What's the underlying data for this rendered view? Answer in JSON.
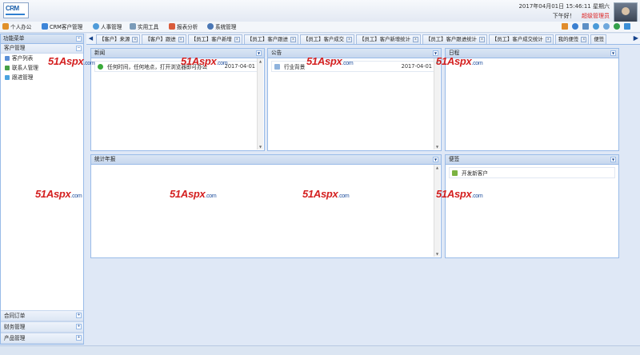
{
  "app": {
    "logo_text": "CRM"
  },
  "header": {
    "datetime": "2017年04月01日 15:46:11 星期六",
    "greeting": "下午好！",
    "user_role": "超级管理员"
  },
  "menu": [
    {
      "label": "个人办公",
      "icon": "home-icon",
      "color": "#e0902a"
    },
    {
      "label": "CRM客户管理",
      "icon": "crm-icon",
      "color": "#3d85d8"
    },
    {
      "label": "人事管理",
      "icon": "people-icon",
      "color": "#4f9bd9"
    },
    {
      "label": "实用工具",
      "icon": "tools-icon",
      "color": "#7a9bb9"
    },
    {
      "label": "报表分析",
      "icon": "chart-icon",
      "color": "#d95b3a"
    },
    {
      "label": "系统管理",
      "icon": "system-icon",
      "color": "#4a77b5"
    }
  ],
  "sidebar": {
    "title": "功能菜单",
    "group": "客户管理",
    "items": [
      {
        "label": "客户列表",
        "icon": "customer-list-icon",
        "color": "#5a8fd6"
      },
      {
        "label": "联系人管理",
        "icon": "contact-icon",
        "color": "#46a046"
      },
      {
        "label": "跟进管理",
        "icon": "followup-icon",
        "color": "#4aa3df"
      }
    ],
    "bottom_groups": [
      "合同订单",
      "财务管理",
      "产品管理"
    ]
  },
  "tabs": [
    "【客户】来源",
    "【客户】跟进",
    "【员工】客户新增",
    "【员工】客户跟进",
    "【员工】客户成交",
    "【员工】客户新增统计",
    "【员工】客户跟进统计",
    "【员工】客户成交统计",
    "我的便签",
    "便签"
  ],
  "panels": {
    "news": {
      "title": "新闻",
      "rows": [
        {
          "text": "任何时间，任何地点，打开浏览器即可办公",
          "date": "2017-04-01"
        }
      ]
    },
    "notice": {
      "title": "公告",
      "rows": [
        {
          "text": "行业背景",
          "date": "2017-04-01"
        }
      ]
    },
    "schedule": {
      "title": "日程"
    },
    "stats": {
      "title": "统计年报"
    },
    "notes": {
      "title": "便签",
      "rows": [
        {
          "text": "开发新客户"
        }
      ]
    }
  },
  "watermark": {
    "main": "51Aspx",
    "suffix": ".com"
  }
}
